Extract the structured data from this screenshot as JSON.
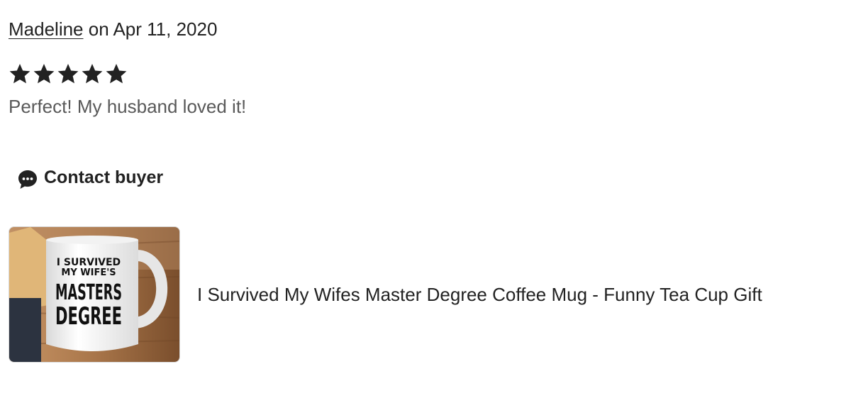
{
  "review": {
    "reviewer_name": "Madeline",
    "date_text": " on Apr 11, 2020",
    "rating": 5,
    "rating_max": 5,
    "text": "Perfect! My husband loved it!"
  },
  "actions": {
    "contact_buyer_label": "Contact buyer",
    "contact_icon": "chat-bubble-icon"
  },
  "listing": {
    "title": "I Survived My Wifes Master Degree Coffee Mug - Funny Tea Cup Gift",
    "thumbnail": {
      "mug_text_line1": "I SURVIVED",
      "mug_text_line2": "MY WIFE'S",
      "mug_text_line3": "MASTERS",
      "mug_text_line4": "DEGREE"
    }
  },
  "colors": {
    "text_primary": "#222222",
    "text_secondary": "#595959",
    "star": "#222222",
    "wood": "#a9764a"
  }
}
